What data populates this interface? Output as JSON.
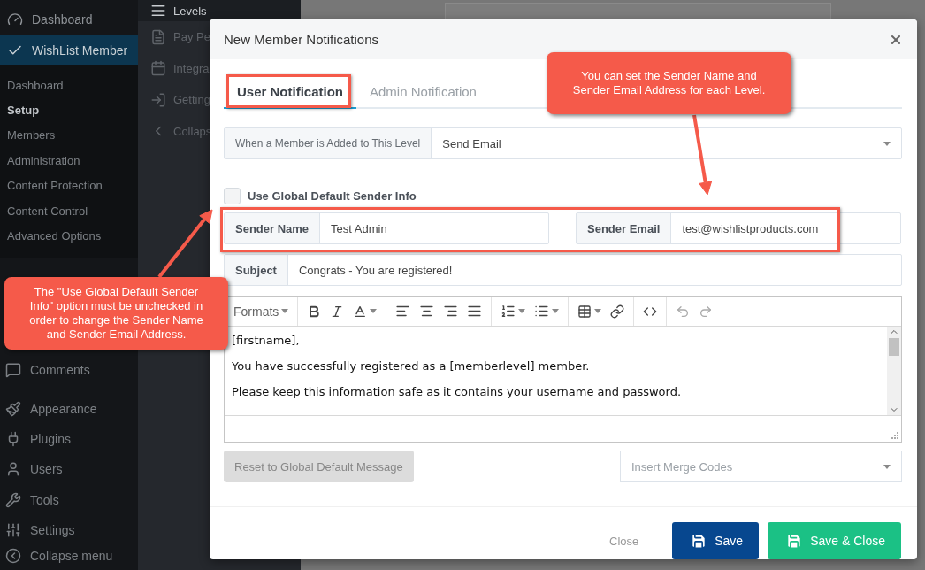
{
  "sidebar": {
    "menu": [
      {
        "label": "Dashboard",
        "selected": false
      },
      {
        "label": "WishList Member",
        "selected": true
      }
    ],
    "submenu": [
      {
        "label": "Dashboard",
        "selected": false
      },
      {
        "label": "Setup",
        "selected": true
      },
      {
        "label": "Members",
        "selected": false
      },
      {
        "label": "Administration",
        "selected": false
      },
      {
        "label": "Content Protection",
        "selected": false
      },
      {
        "label": "Content Control",
        "selected": false
      },
      {
        "label": "Advanced Options",
        "selected": false
      }
    ],
    "menu_lower": [
      {
        "label": "Comments"
      },
      {
        "label": "Appearance"
      },
      {
        "label": "Plugins"
      },
      {
        "label": "Users"
      },
      {
        "label": "Tools"
      },
      {
        "label": "Settings"
      },
      {
        "label": "Collapse menu"
      }
    ]
  },
  "secondary_menu": {
    "items": [
      {
        "label": "Levels",
        "selected": true
      },
      {
        "label": "Pay Pe",
        "selected": false
      },
      {
        "label": "Integra",
        "selected": false
      },
      {
        "label": "Getting",
        "selected": false
      },
      {
        "label": "Collaps",
        "selected": false
      }
    ]
  },
  "dialog": {
    "title": "New Member Notifications",
    "tabs": [
      {
        "label": "User Notification",
        "selected": true
      },
      {
        "label": "Admin Notification",
        "selected": false
      }
    ],
    "trigger": {
      "label": "When a Member is Added to This Level",
      "value": "Send Email"
    },
    "use_global_sender": {
      "label": "Use Global Default Sender Info",
      "checked": false
    },
    "sender_name": {
      "label": "Sender Name",
      "value": "Test Admin"
    },
    "sender_email": {
      "label": "Sender Email",
      "value": "test@wishlistproducts.com"
    },
    "subject": {
      "label": "Subject",
      "value": "Congrats - You are registered!"
    },
    "editor": {
      "formats": "Formats",
      "paragraphs": [
        "[firstname],",
        "You have successfully registered as a [memberlevel] member.",
        "Please keep this information safe as it contains your username and password."
      ]
    },
    "reset_button": "Reset to Global Default Message",
    "merge_codes": {
      "placeholder": "Insert Merge Codes"
    },
    "buttons": {
      "close": "Close",
      "save": "Save",
      "save_close": "Save & Close"
    }
  },
  "callouts": [
    {
      "text": "You can set the Sender Name and Sender Email Address for each Level."
    },
    {
      "text": "The \"Use Global Default Sender Info\" option must be unchecked in order to change the Sender Name and Sender Email Address."
    }
  ]
}
